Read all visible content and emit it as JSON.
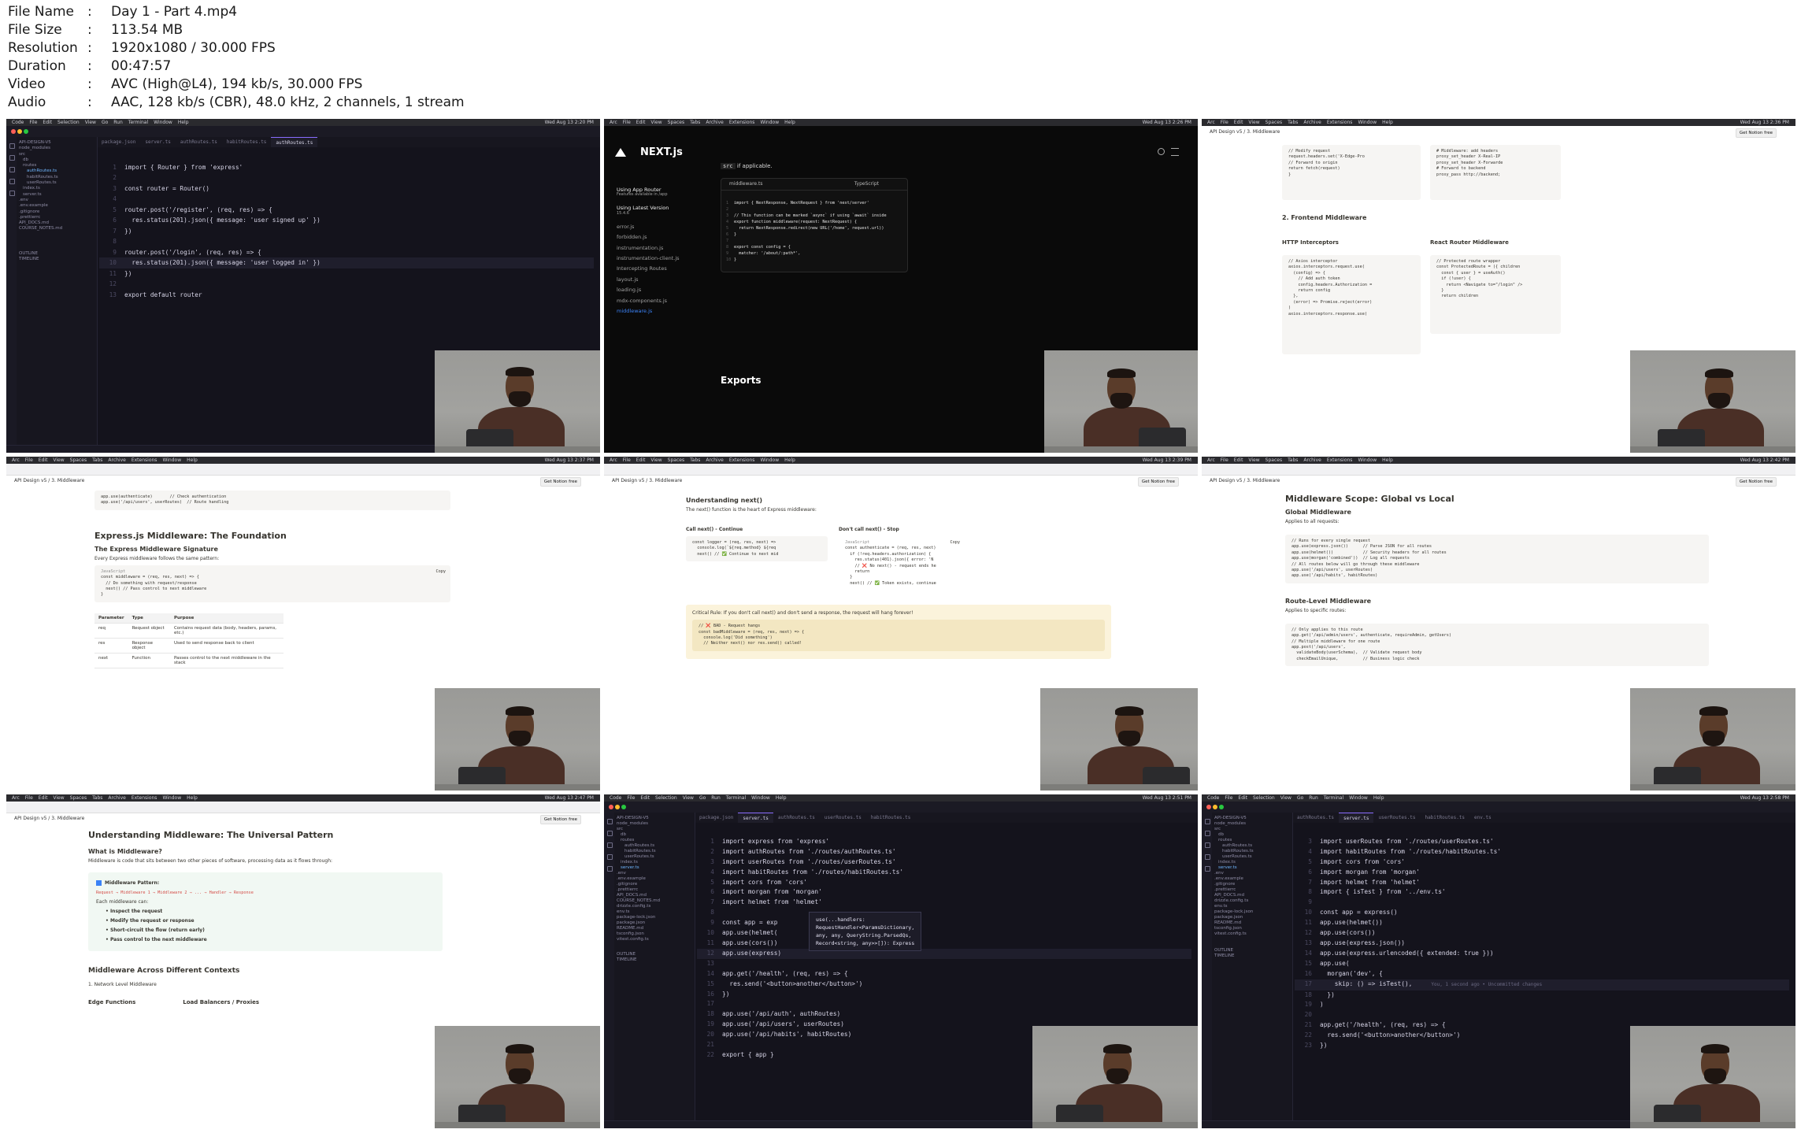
{
  "file_info": [
    {
      "key": "File Name",
      "value": "Day 1 - Part 4.mp4"
    },
    {
      "key": "File Size",
      "value": "113.54 MB"
    },
    {
      "key": "Resolution",
      "value": "1920x1080 / 30.000 FPS"
    },
    {
      "key": "Duration",
      "value": "00:47:57"
    },
    {
      "key": "Video",
      "value": "AVC (High@L4), 194 kb/s, 30.000 FPS"
    },
    {
      "key": "Audio",
      "value": "AAC, 128 kb/s (CBR), 48.0 kHz, 2 channels, 1 stream"
    }
  ],
  "menubar": [
    "Code",
    "File",
    "Edit",
    "Selection",
    "View",
    "Go",
    "Run",
    "Terminal",
    "Window",
    "Help"
  ],
  "browser_menubar": [
    "Arc",
    "File",
    "Edit",
    "View",
    "Spaces",
    "Tabs",
    "Archive",
    "Extensions",
    "Window",
    "Help"
  ],
  "thumbs": {
    "t1": {
      "clock": "Wed Aug 13 2:20 PM",
      "tabs": [
        "package.json",
        "server.ts",
        "authRoutes.ts",
        "habitRoutes.ts",
        "authRoutes.ts"
      ],
      "tree": [
        "API-DESIGN-V5",
        "node_modules",
        "src",
        "db",
        "routes",
        "authRoutes.ts",
        "habitRoutes.ts",
        "userRoutes.ts",
        "index.ts",
        "server.ts",
        ".env",
        ".env.example",
        ".gitignore",
        ".prettierrc",
        "API_DOCS.md",
        "COURSE_NOTES.md",
        "OUTLINE",
        "TIMELINE"
      ],
      "code": [
        "import { Router } from 'express'",
        "",
        "const router = Router()",
        "",
        "router.post('/register', (req, res) => {",
        "  res.status(201).json({ message: 'user signed up' })",
        "})",
        "",
        "router.post('/login', (req, res) => {",
        "  res.status(201).json({ message: 'user logged in' })",
        "})",
        "",
        "export default router"
      ]
    },
    "t2": {
      "clock": "Wed Aug 13 2:26 PM",
      "logo": "NEXT.js",
      "snippet_intro": "if applicable.",
      "sidebar": [
        "Using App Router",
        "Features available in /app",
        "Using Latest Version",
        "15.4.6",
        "error.js",
        "forbidden.js",
        "instrumentation.js",
        "instrumentation-client.js",
        "Intercepting Routes",
        "layout.js",
        "loading.js",
        "mdx-components.js",
        "middleware.js"
      ],
      "file": "middleware.ts",
      "lang": "TypeScript",
      "code": [
        "import { NextResponse, NextRequest } from 'next/server'",
        "",
        "// This function can be marked `async` if using `await` inside",
        "export function middleware(request: NextRequest) {",
        "  return NextResponse.redirect(new URL('/home', request.url))",
        "}",
        "",
        "export const config = {",
        "  matcher: '/about/:path*',",
        "}"
      ],
      "exports": "Exports"
    },
    "t3": {
      "clock": "Wed Aug 13 2:36 PM",
      "crumb": "API Design v5  /  3. Middleware",
      "get_notion": "Get Notion free",
      "h_frontend": "2. Frontend Middleware",
      "col1": "HTTP Interceptors",
      "col2": "React Router Middleware",
      "code_a": [
        "// Modify request",
        "request.headers.set('X-Edge-Pro",
        "",
        "// Forward to origin",
        "return fetch(request)",
        "}"
      ],
      "code_b": [
        "# Middleware: add headers",
        "proxy_set_header X-Real-IP",
        "proxy_set_header X-Forwarde",
        "",
        "# Forward to backend",
        "proxy_pass http://backend;"
      ],
      "code_c": [
        "// Axios interceptor",
        "axios.interceptors.request.use(",
        "  (config) => {",
        "    // Add auth token",
        "    config.headers.Authorization =",
        "    return config",
        "  },",
        "  (error) => Promise.reject(error)",
        ")",
        "",
        "axios.interceptors.response.use("
      ],
      "code_d": [
        "// Protected route wrapper",
        "const ProtectedRoute = ({ children",
        "  const { user } = useAuth()",
        "",
        "  if (!user) {",
        "    return <Navigate to=\"/login\" />",
        "  }",
        "",
        "  return children"
      ]
    },
    "t4": {
      "clock": "Wed Aug 13 2:37 PM",
      "crumb": "API Design v5  /  3. Middleware",
      "get_notion": "Get Notion free",
      "code_top": [
        "app.use(authenticate)       // Check authentication",
        "app.use('/api/users', userRoutes)  // Route handling"
      ],
      "h2": "Express.js Middleware: The Foundation",
      "h3": "The Express Middleware Signature",
      "p": "Every Express middleware follows the same pattern:",
      "code_lang": "JavaScript",
      "copy": "Copy",
      "code": [
        "const middleware = (req, res, next) => {",
        "  // Do something with request/response",
        "  next() // Pass control to next middleware",
        "}"
      ],
      "table": [
        [
          "Parameter",
          "Type",
          "Purpose"
        ],
        [
          "req",
          "Request object",
          "Contains request data (body, headers, params, etc.)"
        ],
        [
          "res",
          "Response object",
          "Used to send response back to client"
        ],
        [
          "next",
          "Function",
          "Passes control to the next middleware in the stack"
        ]
      ]
    },
    "t5": {
      "clock": "Wed Aug 13 2:39 PM",
      "crumb": "API Design v5  /  3. Middleware",
      "get_notion": "Get Notion free",
      "h3": "Understanding next()",
      "p": "The next() function is the heart of Express middleware:",
      "left_title": "Call next() - Continue",
      "right_title": "Don't call next() - Stop",
      "left_code": [
        "const logger = (req, res, next) =>",
        "  console.log(`${req.method} ${req",
        "  next() // ✅ Continue to next mid"
      ],
      "right_code": [
        "const authenticate = (req, res, next)",
        "  if (!req.headers.authorization) {",
        "    res.status(401).json({ error: 'N",
        "    // ❌ No next() - request ends he",
        "    return",
        "  }",
        "  next() // ✅ Token exists, continue"
      ],
      "code_lang": "JavaScript",
      "copy": "Copy",
      "callout": "Critical Rule: If you don't call next() and don't send a response, the request will hang forever!",
      "callout_code": [
        "// ❌ BAD - Request hangs",
        "const badMiddleware = (req, res, next) => {",
        "  console.log('Did something')",
        "  // Neither next() nor res.send() called!"
      ]
    },
    "t6": {
      "clock": "Wed Aug 13 2:42 PM",
      "crumb": "API Design v5  /  3. Middleware",
      "get_notion": "Get Notion free",
      "h2": "Middleware Scope: Global vs Local",
      "h3a": "Global Middleware",
      "pa": "Applies to all requests:",
      "code_a": [
        "// Runs for every single request",
        "app.use(express.json())      // Parse JSON for all routes",
        "app.use(helmet())            // Security headers for all routes",
        "app.use(morgan('combined'))  // Log all requests",
        "",
        "// All routes below will go through these middleware",
        "app.use('/api/users', userRoutes)",
        "app.use('/api/habits', habitRoutes)"
      ],
      "h3b": "Route-Level Middleware",
      "pb": "Applies to specific routes:",
      "code_b": [
        "// Only applies to this route",
        "app.get('/api/admin/users', authenticate, requireAdmin, getUsers)",
        "",
        "// Multiple middleware for one route",
        "app.post('/api/users',",
        "  validateBody(userSchema),  // Validate request body",
        "  checkEmailUnique,          // Business logic check"
      ]
    },
    "t7": {
      "clock": "Wed Aug 13 2:47 PM",
      "crumb": "API Design v5  /  3. Middleware",
      "get_notion": "Get Notion free",
      "h2": "Understanding Middleware: The Universal Pattern",
      "h3": "What is Middleware?",
      "p": "Middleware is code that sits between two other pieces of software, processing data as it flows through:",
      "pattern_title": "Middleware Pattern:",
      "pattern": "Request → Middleware 1 → Middleware 2 → ... → Handler → Response",
      "each": "Each middleware can:",
      "bullets": [
        "Inspect the request",
        "Modify the request or response",
        "Short-circuit the flow (return early)",
        "Pass control to the next middleware"
      ],
      "h2b": "Middleware Across Different Contexts",
      "h3b": "1. Network Level Middleware",
      "col1": "Edge Functions",
      "col2": "Load Balancers / Proxies"
    },
    "t8": {
      "clock": "Wed Aug 13 2:51 PM",
      "tabs": [
        "package.json",
        "server.ts",
        "authRoutes.ts",
        "userRoutes.ts",
        "habitRoutes.ts"
      ],
      "tree": [
        "API-DESIGN-V5",
        "node_modules",
        "src",
        "db",
        "routes",
        "authRoutes.ts",
        "habitRoutes.ts",
        "userRoutes.ts",
        "index.ts",
        "server.ts",
        ".env",
        ".env.example",
        ".gitignore",
        ".prettierrc",
        "API_DOCS.md",
        "COURSE_NOTES.md",
        "drizzle.config.ts",
        "env.ts",
        "package-lock.json",
        "package.json",
        "README.md",
        "tsconfig.json",
        "vitest.config.ts",
        "OUTLINE",
        "TIMELINE"
      ],
      "code": [
        "import express from 'express'",
        "import authRoutes from './routes/authRoutes.ts'",
        "import userRoutes from './routes/userRoutes.ts'",
        "import habitRoutes from './routes/habitRoutes.ts'",
        "import cors from 'cors'",
        "import morgan from 'morgan'",
        "import helmet from 'helmet'",
        "",
        "const app = exp",
        "app.use(helmet(",
        "app.use(cors())",
        "app.use(express)",
        "",
        "app.get('/health', (req, res) => {",
        "  res.send('<button>another</button>')",
        "})",
        "",
        "app.use('/api/auth', authRoutes)",
        "app.use('/api/users', userRoutes)",
        "app.use('/api/habits', habitRoutes)",
        "",
        "export { app }"
      ],
      "tooltip": [
        "use(...handlers:",
        "RequestHandler<ParamsDictionary,",
        "any, any, QueryString.ParsedQs,",
        "Record<string, any>>[]): Express"
      ]
    },
    "t9": {
      "clock": "Wed Aug 13 2:58 PM",
      "tabs": [
        "authRoutes.ts",
        "server.ts",
        "userRoutes.ts",
        "habitRoutes.ts",
        "env.ts"
      ],
      "tree": [
        "API-DESIGN-V5",
        "node_modules",
        "src",
        "db",
        "routes",
        "authRoutes.ts",
        "habitRoutes.ts",
        "userRoutes.ts",
        "index.ts",
        "server.ts",
        ".env",
        ".env.example",
        ".gitignore",
        ".prettierrc",
        "API_DOCS.md",
        "drizzle.config.ts",
        "env.ts",
        "package-lock.json",
        "package.json",
        "README.md",
        "tsconfig.json",
        "vitest.config.ts",
        "OUTLINE",
        "TIMELINE"
      ],
      "code": [
        "import userRoutes from './routes/userRoutes.ts'",
        "import habitRoutes from './routes/habitRoutes.ts'",
        "import cors from 'cors'",
        "import morgan from 'morgan'",
        "import helmet from 'helmet'",
        "import { isTest } from '../env.ts'",
        "",
        "const app = express()",
        "app.use(helmet())",
        "app.use(cors())",
        "app.use(express.json())",
        "app.use(express.urlencoded({ extended: true }))",
        "app.use(",
        "  morgan('dev', {",
        "    skip: () => isTest(),",
        "  })",
        ")",
        "",
        "app.get('/health', (req, res) => {",
        "  res.send('<button>another</button>')",
        "})"
      ],
      "blame": "You, 1 second ago • Uncommitted changes"
    }
  }
}
